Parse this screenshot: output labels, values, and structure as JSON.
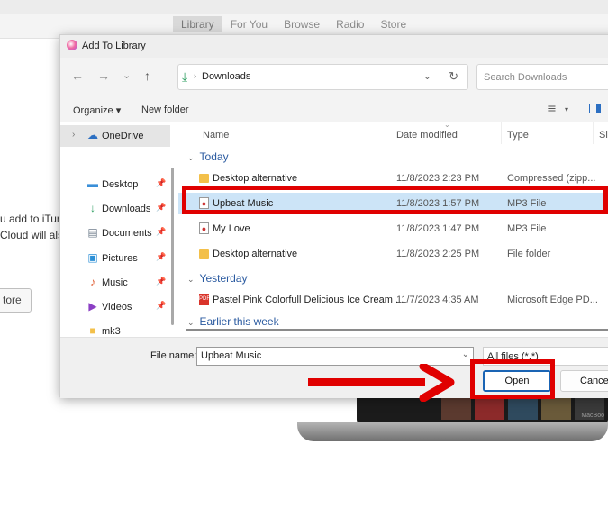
{
  "background": {
    "tabs": [
      "Library",
      "For You",
      "Browse",
      "Radio",
      "Store"
    ],
    "text_line1": "u add to iTun",
    "text_line2": "Cloud will als",
    "store_button": "tore",
    "laptop_brand": "MacBoo"
  },
  "dialog": {
    "title": "Add To Library",
    "nav": {
      "back": "←",
      "forward": "→",
      "recent": "⌄",
      "up": "↑"
    },
    "address": {
      "path": "Downloads",
      "separator": "›",
      "dropdown": "⌄",
      "refresh": "↻"
    },
    "search_placeholder": "Search Downloads",
    "toolbar": {
      "organize": "Organize ▾",
      "new_folder": "New folder",
      "view_icon": "≣",
      "view_dropdown": "▾"
    },
    "sidebar": {
      "items": [
        {
          "label": "OneDrive",
          "icon": "cloud-icon",
          "glyph": "☁",
          "color": "#2c6fc2",
          "pinned": false,
          "selected": true,
          "chevron": "›"
        },
        {
          "label": "Desktop",
          "icon": "desktop-icon",
          "glyph": "▬",
          "color": "#3a8fd8",
          "pinned": true
        },
        {
          "label": "Downloads",
          "icon": "download-icon",
          "glyph": "↓",
          "color": "#2a9d5e",
          "pinned": true
        },
        {
          "label": "Documents",
          "icon": "documents-icon",
          "glyph": "▤",
          "color": "#6f7d8c",
          "pinned": true
        },
        {
          "label": "Pictures",
          "icon": "pictures-icon",
          "glyph": "▣",
          "color": "#2c8fd6",
          "pinned": true
        },
        {
          "label": "Music",
          "icon": "music-icon",
          "glyph": "♪",
          "color": "#e0623a",
          "pinned": true
        },
        {
          "label": "Videos",
          "icon": "videos-icon",
          "glyph": "▶",
          "color": "#8b3fc4",
          "pinned": true
        },
        {
          "label": "mk3",
          "icon": "folder-icon",
          "glyph": "■",
          "color": "#f3c04a",
          "pinned": false
        }
      ],
      "pin_glyph": "📌"
    },
    "columns": {
      "name": "Name",
      "date": "Date modified",
      "type": "Type",
      "size": "Si"
    },
    "groups": [
      {
        "label": "Today",
        "chevron": "⌄"
      },
      {
        "label": "Yesterday",
        "chevron": "⌄"
      },
      {
        "label": "Earlier this week",
        "chevron": "⌄"
      }
    ],
    "files": [
      {
        "name": "Desktop alternative",
        "date": "11/8/2023 2:23 PM",
        "type": "Compressed (zipp...",
        "icon": "zip-folder-icon",
        "selected": false
      },
      {
        "name": "Upbeat Music",
        "date": "11/8/2023 1:57 PM",
        "type": "MP3 File",
        "icon": "mp3-file-icon",
        "selected": true
      },
      {
        "name": "My Love",
        "date": "11/8/2023 1:47 PM",
        "type": "MP3 File",
        "icon": "mp3-file-icon",
        "selected": false
      },
      {
        "name": "Desktop alternative",
        "date": "11/8/2023 2:25 PM",
        "type": "File folder",
        "icon": "folder-icon",
        "selected": false
      },
      {
        "name": "Pastel Pink Colorfull Delicious Ice Cream ...",
        "date": "11/7/2023 4:35 AM",
        "type": "Microsoft Edge PD...",
        "icon": "pdf-file-icon",
        "selected": false
      }
    ],
    "bottom": {
      "file_name_label": "File name:",
      "file_name_value": "Upbeat Music",
      "filter": "All files (*.*)",
      "open_button": "Open",
      "cancel_button": "Cancel"
    }
  },
  "annotations": {
    "highlight_color": "#e00000"
  }
}
